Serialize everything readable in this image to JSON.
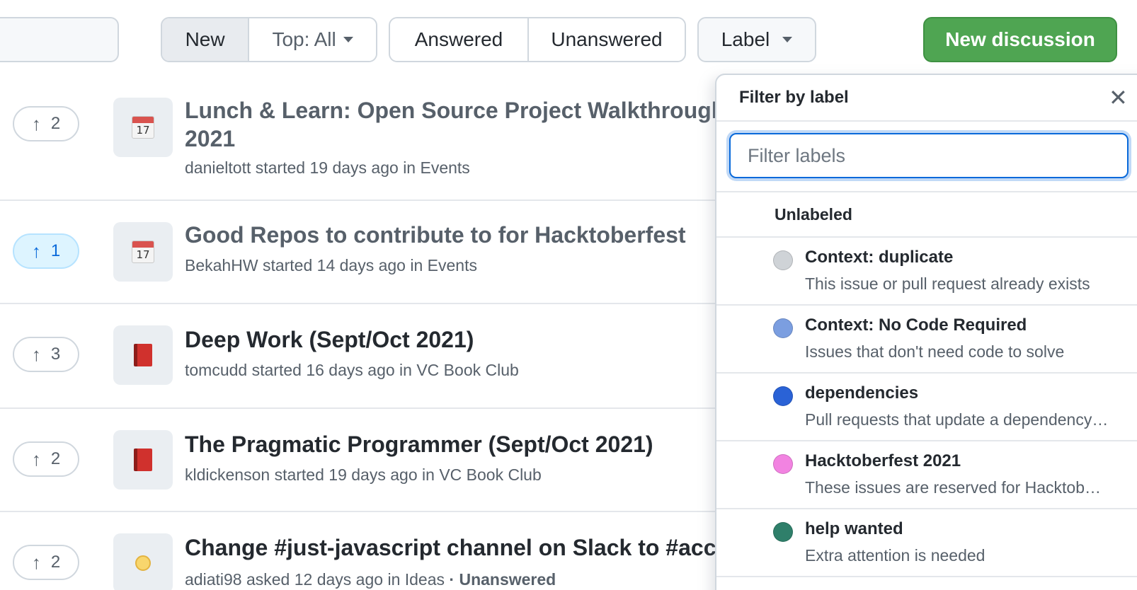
{
  "toolbar": {
    "sort_new": "New",
    "sort_top": "Top: All",
    "answered": "Answered",
    "unanswered": "Unanswered",
    "label": "Label",
    "new_discussion": "New discussion"
  },
  "discussions": [
    {
      "votes": "2",
      "title_line1": "Lunch & Learn: Open Source Project Walkthrough",
      "title_line2": "2021",
      "author": "danieltott",
      "verb": "started",
      "age": "19 days ago",
      "in": "in",
      "category": "Events",
      "icon": "calendar-icon",
      "day": "17"
    },
    {
      "votes": "1",
      "title": "Good Repos to contribute to for Hacktoberfest",
      "author": "BekahHW",
      "verb": "started",
      "age": "14 days ago",
      "in": "in",
      "category": "Events",
      "icon": "calendar-icon",
      "day": "17"
    },
    {
      "votes": "3",
      "title": "Deep Work (Sept/Oct 2021)",
      "author": "tomcudd",
      "verb": "started",
      "age": "16 days ago",
      "in": "in",
      "category": "VC Book Club",
      "icon": "book-icon"
    },
    {
      "votes": "2",
      "title": "The Pragmatic Programmer (Sept/Oct 2021)",
      "author": "kldickenson",
      "verb": "started",
      "age": "19 days ago",
      "in": "in",
      "category": "VC Book Club",
      "icon": "book-icon"
    },
    {
      "votes": "2",
      "title": "Change #just-javascript channel on Slack to #acc",
      "author": "adiati98",
      "verb": "asked",
      "age": "12 days ago",
      "in": "in",
      "category": "Ideas",
      "status": "Unanswered",
      "icon": "lightbulb-icon"
    }
  ],
  "filter_panel": {
    "title": "Filter by label",
    "placeholder": "Filter labels",
    "unlabeled": "Unlabeled",
    "labels": [
      {
        "name": "Context: duplicate",
        "description": "This issue or pull request already exists",
        "color": "#cfd3d7"
      },
      {
        "name": "Context: No Code Required",
        "description": "Issues that don't need code to solve",
        "color": "#7b9ee0"
      },
      {
        "name": "dependencies",
        "description": "Pull requests that update a dependency file",
        "color": "#2a62d6"
      },
      {
        "name": "Hacktoberfest 2021",
        "description": "These issues are reserved for Hacktoberfest",
        "color": "#f283e1"
      },
      {
        "name": "help wanted",
        "description": "Extra attention is needed",
        "color": "#2f7f6a"
      }
    ]
  },
  "colors": {
    "primary_button": "#4fa552",
    "accent": "#0969da"
  }
}
